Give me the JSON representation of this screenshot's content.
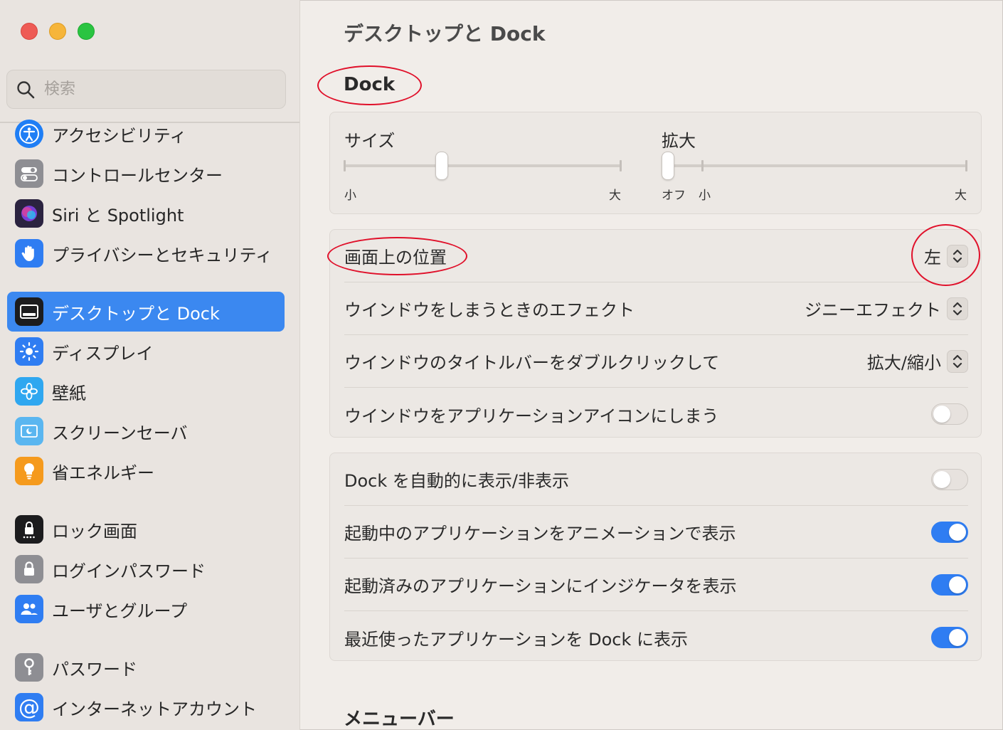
{
  "sidebar": {
    "search_placeholder": "検索",
    "items": [
      {
        "label": "アクセシビリティ",
        "icon": "accessibility-icon",
        "color": "#1f7ef5"
      },
      {
        "label": "コントロールセンター",
        "icon": "control-center-icon",
        "color": "#8e8e93"
      },
      {
        "label": "Siri と Spotlight",
        "icon": "siri-icon",
        "color": "#2b2340"
      },
      {
        "label": "プライバシーとセキュリティ",
        "icon": "hand-icon",
        "color": "#2f7df2"
      },
      {
        "label": "デスクトップと Dock",
        "icon": "dock-icon",
        "color": "#1c1c1e",
        "selected": true
      },
      {
        "label": "ディスプレイ",
        "icon": "display-icon",
        "color": "#2f7df2"
      },
      {
        "label": "壁紙",
        "icon": "wallpaper-icon",
        "color": "#2fa7f0"
      },
      {
        "label": "スクリーンセーバ",
        "icon": "screensaver-icon",
        "color": "#5ab6f0"
      },
      {
        "label": "省エネルギー",
        "icon": "energy-icon",
        "color": "#f59a1d"
      },
      {
        "label": "ロック画面",
        "icon": "lock-screen-icon",
        "color": "#1c1c1e"
      },
      {
        "label": "ログインパスワード",
        "icon": "login-password-icon",
        "color": "#8e8e93"
      },
      {
        "label": "ユーザとグループ",
        "icon": "users-groups-icon",
        "color": "#2f7df2"
      },
      {
        "label": "パスワード",
        "icon": "key-icon",
        "color": "#8e8e93"
      },
      {
        "label": "インターネットアカウント",
        "icon": "internet-accounts-icon",
        "color": "#2f7df2"
      }
    ]
  },
  "main": {
    "title": "デスクトップと Dock",
    "dock_section": "Dock",
    "size": {
      "label": "サイズ",
      "min": "小",
      "max": "大",
      "value": 0.35
    },
    "magnification": {
      "label": "拡大",
      "off": "オフ",
      "min": "小",
      "max": "大",
      "value": 0.0
    },
    "rows1": [
      {
        "label": "画面上の位置",
        "type": "popup",
        "value": "左"
      },
      {
        "label": "ウインドウをしまうときのエフェクト",
        "type": "popup",
        "value": "ジニーエフェクト"
      },
      {
        "label": "ウインドウのタイトルバーをダブルクリックして",
        "type": "popup",
        "value": "拡大/縮小"
      },
      {
        "label": "ウインドウをアプリケーションアイコンにしまう",
        "type": "toggle",
        "on": false
      }
    ],
    "rows2": [
      {
        "label": "Dock を自動的に表示/非表示",
        "type": "toggle",
        "on": false
      },
      {
        "label": "起動中のアプリケーションをアニメーションで表示",
        "type": "toggle",
        "on": true
      },
      {
        "label": "起動済みのアプリケーションにインジケータを表示",
        "type": "toggle",
        "on": true
      },
      {
        "label": "最近使ったアプリケーションを Dock に表示",
        "type": "toggle",
        "on": true
      }
    ],
    "menubar_section": "メニューバー"
  },
  "colors": {
    "accent": "#2f7df2",
    "annotation": "#e0102a"
  }
}
